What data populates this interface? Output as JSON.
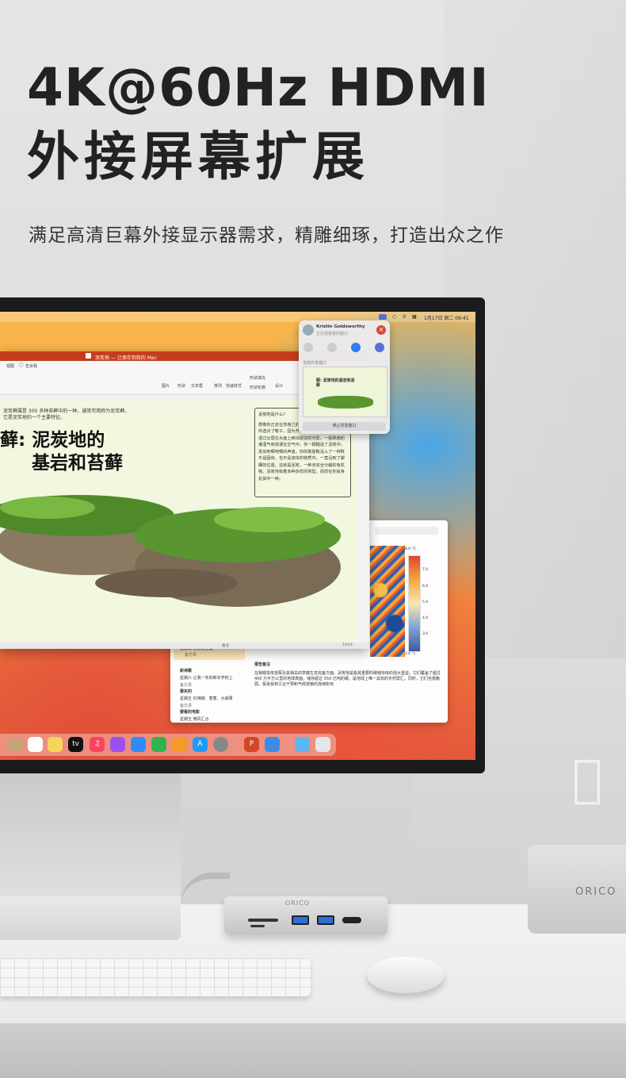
{
  "headline": {
    "line1": "4K@60Hz HDMI",
    "line2": "外接屏幕扩展",
    "subtitle": "满足高清巨幕外接显示器需求，精雕细琢，打造出众之作"
  },
  "menubar": {
    "datetime": "1月17日 周二  09:41"
  },
  "ppt": {
    "title": "泥炭地 — 已保存到我的 Mac",
    "menu": [
      "视图",
      "告诉我"
    ],
    "ribbon": [
      "图片",
      "形状",
      "文本框",
      "排列",
      "快速样式",
      "形状填充",
      "形状轮廓",
      "设计"
    ],
    "slide_small_line1": "泥炭藓属是 300 多种苔藓中的一种，通常可简称为泥炭藓。",
    "slide_small_line2": "它是泥炭地的一个主要特征。",
    "slide_title_line1": "藓: 泥炭地的",
    "slide_title_line2": "基岩和苔藓",
    "textbox_title": "泥炭地是什么?",
    "textbox_body": "想像你正走在苏格兰的一片湿地上。好在出门前你选对了鞋子，因为开阔的地面湿漉漉的。阳光透过云层在水面上映出斑驳的光影。一股熟悉的潮湿气味弥漫在空气中，你一脚踏进了泥炭中，发出吧唧吧唧的声音。你的橡胶靴没入了一种既不是固体、也不是液体的物质中，一直没到了脚踝的位置。这就是泥炭，一种未完全分解的有机物。泥炭地有着多种多样的类型，而现在你就身处其中一种。",
    "status_left": "备注",
    "status_zoom": "141%"
  },
  "share": {
    "name": "Kristin Goldsworthy",
    "status": "正在观看我的窗口",
    "section": "当前共享窗口",
    "stop": "停止共享窗口",
    "thumb_title": "藓: 泥炭地的基岩和苔藓"
  },
  "notes": {
    "items": [
      {
        "title": "新诗歌",
        "meta": "星期六  让我一年的新年学校上",
        "folder": "备忘录"
      },
      {
        "title": "要买的",
        "meta": "星期五  红辣椒、香葱、大蒜果",
        "folder": "备忘录"
      },
      {
        "title": "要看的电影",
        "meta": "星期五  微风汇合",
        "folder": ""
      }
    ],
    "header_item": "星期日  泥炭藓全集",
    "header_folder": "备忘录",
    "body_title": "报告备注",
    "body_text": "在我眼变体苔藓及其相关的草藤生态完备方面。泥炭地是极其重要的碳储存库的强大堡垒。它们覆盖了超过 400 万平方公里的地球表面，储存超过 550 亿吨的碳，是地球上唯一具效的天然屏汇。同时，它们也很脆弱，极易受到工业干预和气候变暖的连续影响",
    "scale_top": "8.0 °C",
    "scale_ticks": [
      "7.0",
      "6.0",
      "5.0",
      "4.0",
      "3.0"
    ],
    "scale_bottom": "2.0 °C"
  },
  "dock": {
    "apps": [
      "contacts",
      "reminders",
      "notes",
      "tv",
      "music",
      "podcasts",
      "keynote",
      "numbers",
      "pages",
      "app-store",
      "system-settings",
      "powerpoint",
      "weather",
      "folder",
      "trash"
    ],
    "tv_label": "tv"
  },
  "hardware": {
    "brand": "ORICO",
    "hub_brand": "ORICO"
  },
  "colors": {
    "headline": "#222222",
    "ppt_accent": "#c43e1c",
    "share_stop": "#e0453a"
  }
}
